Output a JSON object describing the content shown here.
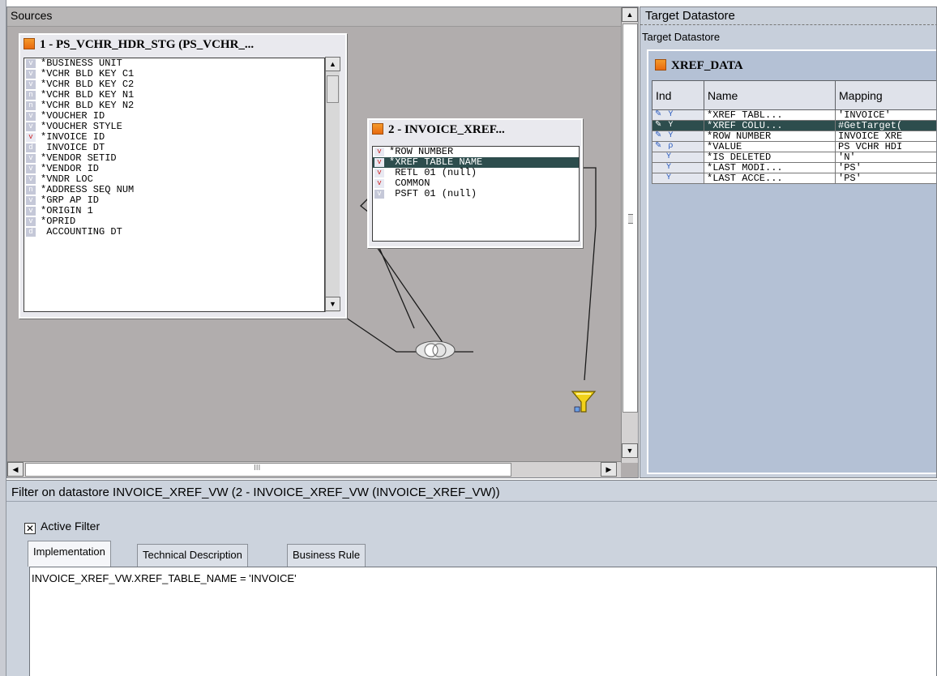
{
  "sources": {
    "header": "Sources",
    "datastore1": {
      "title": "1 - PS_VCHR_HDR_STG (PS_VCHR_...",
      "rows": [
        {
          "label": "*BUSINESS UNIT",
          "mark": "v"
        },
        {
          "label": "*VCHR BLD KEY C1",
          "mark": "v"
        },
        {
          "label": "*VCHR BLD KEY C2",
          "mark": "v"
        },
        {
          "label": "*VCHR BLD KEY N1",
          "mark": "n"
        },
        {
          "label": "*VCHR BLD KEY N2",
          "mark": "n"
        },
        {
          "label": "*VOUCHER ID",
          "mark": "v"
        },
        {
          "label": "*VOUCHER STYLE",
          "mark": "v"
        },
        {
          "label": "*INVOICE ID",
          "mark": "v",
          "red": true
        },
        {
          "label": " INVOICE DT",
          "mark": "d"
        },
        {
          "label": "*VENDOR SETID",
          "mark": "v"
        },
        {
          "label": "*VENDOR ID",
          "mark": "v"
        },
        {
          "label": "*VNDR LOC",
          "mark": "v"
        },
        {
          "label": "*ADDRESS SEQ NUM",
          "mark": "n"
        },
        {
          "label": "*GRP AP ID",
          "mark": "v"
        },
        {
          "label": "*ORIGIN 1",
          "mark": "v"
        },
        {
          "label": "*OPRID",
          "mark": "v"
        },
        {
          "label": " ACCOUNTING DT",
          "mark": "d"
        }
      ]
    },
    "datastore2": {
      "title": "2 - INVOICE_XREF...",
      "rows": [
        {
          "label": "*ROW NUMBER",
          "mark": "v",
          "red": true
        },
        {
          "label": "*XREF TABLE NAME",
          "mark": "v",
          "red": true,
          "selected": true
        },
        {
          "label": " RETL 01 (null)",
          "mark": "v",
          "red": true
        },
        {
          "label": " COMMON",
          "mark": "v",
          "red": true
        },
        {
          "label": " PSFT 01 (null)",
          "mark": "v"
        }
      ]
    },
    "hscroll_grip": "III"
  },
  "target": {
    "header": "Target Datastore",
    "subheader": "Target Datastore",
    "table_title": "XREF_DATA",
    "columns": [
      "Ind",
      "Name",
      "Mapping"
    ],
    "rows": [
      {
        "ind": "✎ Y",
        "name": "*XREF TABL...",
        "mapping": "'INVOICE'"
      },
      {
        "ind": "✎ Y",
        "name": "*XREF COLU...",
        "mapping": "#GetTarget(",
        "selected": true
      },
      {
        "ind": "✎ Y",
        "name": "*ROW NUMBER",
        "mapping": "INVOICE XRE"
      },
      {
        "ind": "✎ ρ",
        "name": "*VALUE",
        "mapping": "PS VCHR HDI"
      },
      {
        "ind": "  Y",
        "name": "*IS DELETED",
        "mapping": "'N'"
      },
      {
        "ind": "  Y",
        "name": "*LAST MODI...",
        "mapping": "'PS'"
      },
      {
        "ind": "  Y",
        "name": "*LAST ACCE...",
        "mapping": "'PS'"
      }
    ]
  },
  "filter": {
    "header": "Filter on datastore INVOICE_XREF_VW (2 - INVOICE_XREF_VW (INVOICE_XREF_VW))",
    "active_filter_label": "Active Filter",
    "active_filter_checked": "✕",
    "tabs": [
      "Implementation",
      "Technical Description",
      "Business Rule"
    ],
    "expression": "INVOICE_XREF_VW.XREF_TABLE_NAME = 'INVOICE'"
  },
  "colors": {
    "canvas": "#b1adad",
    "selection": "#2d4d4d",
    "filter_icon": "#f2d21a",
    "target_bg": "#b4c1d5"
  },
  "icons": {
    "datastore": "table-icon",
    "join": "join-icon",
    "filter": "filter-funnel-icon"
  }
}
